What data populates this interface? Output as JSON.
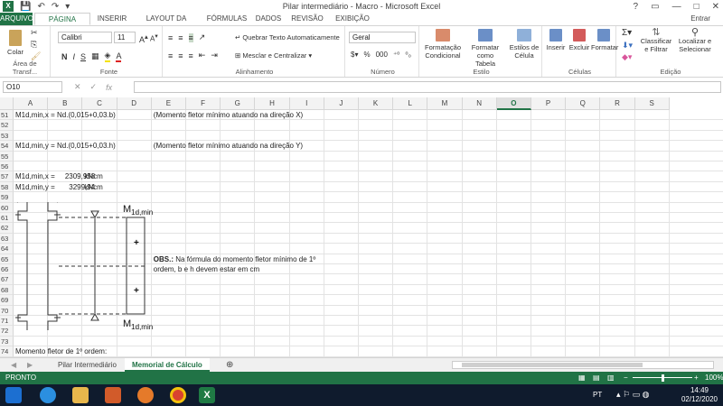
{
  "window": {
    "title": "Pilar intermediário - Macro - Microsoft Excel",
    "help": "?",
    "minimize": "—",
    "restore": "□",
    "close": "✕",
    "signin": "Entrar"
  },
  "ribbon_tabs": [
    "ARQUIVO",
    "PÁGINA INICIAL",
    "INSERIR",
    "LAYOUT DA PÁGINA",
    "FÓRMULAS",
    "DADOS",
    "REVISÃO",
    "EXIBIÇÃO"
  ],
  "ribbon": {
    "paste": "Colar",
    "clipboard": "Área de Transf...",
    "font_name": "Calibri",
    "font_size": "11",
    "bold": "N",
    "italic": "I",
    "underline": "S",
    "font_group": "Fonte",
    "wrap_text": "Quebrar Texto Automaticamente",
    "merge_center": "Mesclar e Centralizar",
    "alignment_group": "Alinhamento",
    "number_format": "Geral",
    "number_group": "Número",
    "cond_format": [
      "Formatação",
      "Condicional"
    ],
    "format_table": [
      "Formatar como",
      "Tabela"
    ],
    "cell_styles": [
      "Estilos de",
      "Célula"
    ],
    "style_group": "Estilo",
    "insert": "Inserir",
    "delete": "Excluir",
    "format": "Formatar",
    "cells_group": "Células",
    "sort_filter": [
      "Classificar",
      "e Filtrar"
    ],
    "find_select": [
      "Localizar e",
      "Selecionar"
    ],
    "editing_group": "Edição"
  },
  "formula_bar": {
    "name_box": "O10",
    "fx": "fx",
    "content": ""
  },
  "columns": [
    "A",
    "B",
    "C",
    "D",
    "E",
    "F",
    "G",
    "H",
    "I",
    "J",
    "K",
    "L",
    "M",
    "N",
    "O",
    "P",
    "Q",
    "R",
    "S"
  ],
  "selected_column": "O",
  "rows": [
    "51",
    "52",
    "53",
    "54",
    "55",
    "56",
    "57",
    "58",
    "59",
    "60",
    "61",
    "62",
    "63",
    "64",
    "65",
    "66",
    "67",
    "68",
    "69",
    "70",
    "71",
    "72",
    "73",
    "74"
  ],
  "cells": {
    "r51_a": "M1d,min,x = Nd.(0,015+0,03.b)",
    "r51_e": "(Momento fletor mínimo atuando na direção X)",
    "r54_a": "M1d,min,y = Nd.(0,015+0,03.h)",
    "r54_e": "(Momento fletor mínimo atuando na direção Y)",
    "r57_a": "M1d,min,x =",
    "r57_b": "2309,958",
    "r57_c": "kNcm",
    "r58_a": "M1d,min,y =",
    "r58_b": "3299,94",
    "r58_c": "kNcm",
    "obs_bold": "OBS.:",
    "obs_text1": " Na fórmula do momento fletor mínimo de 1º",
    "obs_text2": "ordem, b e h devem estar em cm",
    "r74_a": "Momento fletor de 1º ordem:"
  },
  "diagram": {
    "top_label": "M",
    "top_sub": "1d,min",
    "bottom_label": "M",
    "bottom_sub": "1d,min",
    "plus": "+"
  },
  "sheet_tabs": [
    "Pilar Intermediário",
    "Memorial de Cálculo"
  ],
  "active_sheet": "Memorial de Cálculo",
  "status": {
    "mode": "PRONTO",
    "zoom": "100%"
  },
  "taskbar": {
    "lang": "PT",
    "time": "14:49",
    "date": "02/12/2020"
  }
}
